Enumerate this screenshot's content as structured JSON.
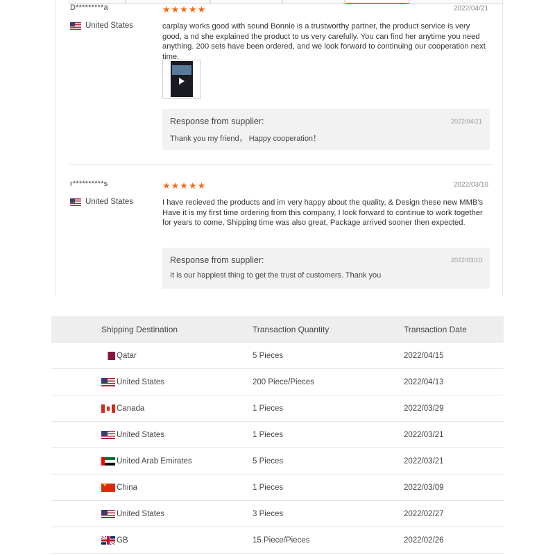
{
  "reviews": [
    {
      "user": "D*********a",
      "stars": "★★★★★",
      "date": "2022/04/21",
      "country": "United States",
      "text": "carplay works good with sound Bonnie is a trustworthy partner, the product service is very good, a nd she explained the product to us very carefully. You can find her anytime you need anything. 200 sets have been ordered, and we look forward to continuing our cooperation next time.",
      "has_media": true,
      "response": {
        "title": "Response from supplier:",
        "date": "2022/04/21",
        "text": "Thank you my friend， Happy cooperation！"
      }
    },
    {
      "user": "r**********s",
      "stars": "★★★★★",
      "date": "2022/03/10",
      "country": "United States",
      "text": "I have recieved the products and im very happy about the quality, & Design these new MMB's Have it is my first time ordering from this company, I look forward to continue to work together for years to come, Shipping time was also great, Package arrived sooner then expected.",
      "has_media": false,
      "response": {
        "title": "Response from supplier:",
        "date": "2022/03/10",
        "text": "It is our happiest thing to get the trust of customers. Thank you"
      }
    }
  ],
  "shipping": {
    "headers": {
      "destination": "Shipping Destination",
      "quantity": "Transaction Quantity",
      "date": "Transaction Date"
    },
    "rows": [
      {
        "flag": "qa",
        "destination": "Qatar",
        "quantity": "5 Pieces",
        "date": "2022/04/15"
      },
      {
        "flag": "us",
        "destination": "United States",
        "quantity": "200 Piece/Pieces",
        "date": "2022/04/13"
      },
      {
        "flag": "ca",
        "destination": "Canada",
        "quantity": "1 Pieces",
        "date": "2022/03/29"
      },
      {
        "flag": "us",
        "destination": "United States",
        "quantity": "1 Pieces",
        "date": "2022/03/21"
      },
      {
        "flag": "ae",
        "destination": "United Arab Emirates",
        "quantity": "5 Pieces",
        "date": "2022/03/21"
      },
      {
        "flag": "cn",
        "destination": "China",
        "quantity": "1 Pieces",
        "date": "2022/03/09"
      },
      {
        "flag": "us",
        "destination": "United States",
        "quantity": "3 Pieces",
        "date": "2022/02/27"
      },
      {
        "flag": "gb",
        "destination": "GB",
        "quantity": "15 Piece/Pieces",
        "date": "2022/02/26"
      }
    ]
  },
  "colors": {
    "star": "#f46b1b",
    "response_bg": "#f2f2f2",
    "table_header_bg": "#eeeeee"
  },
  "icons": {
    "star": "star-icon",
    "play": "play-icon",
    "flag": "flag-icon"
  }
}
